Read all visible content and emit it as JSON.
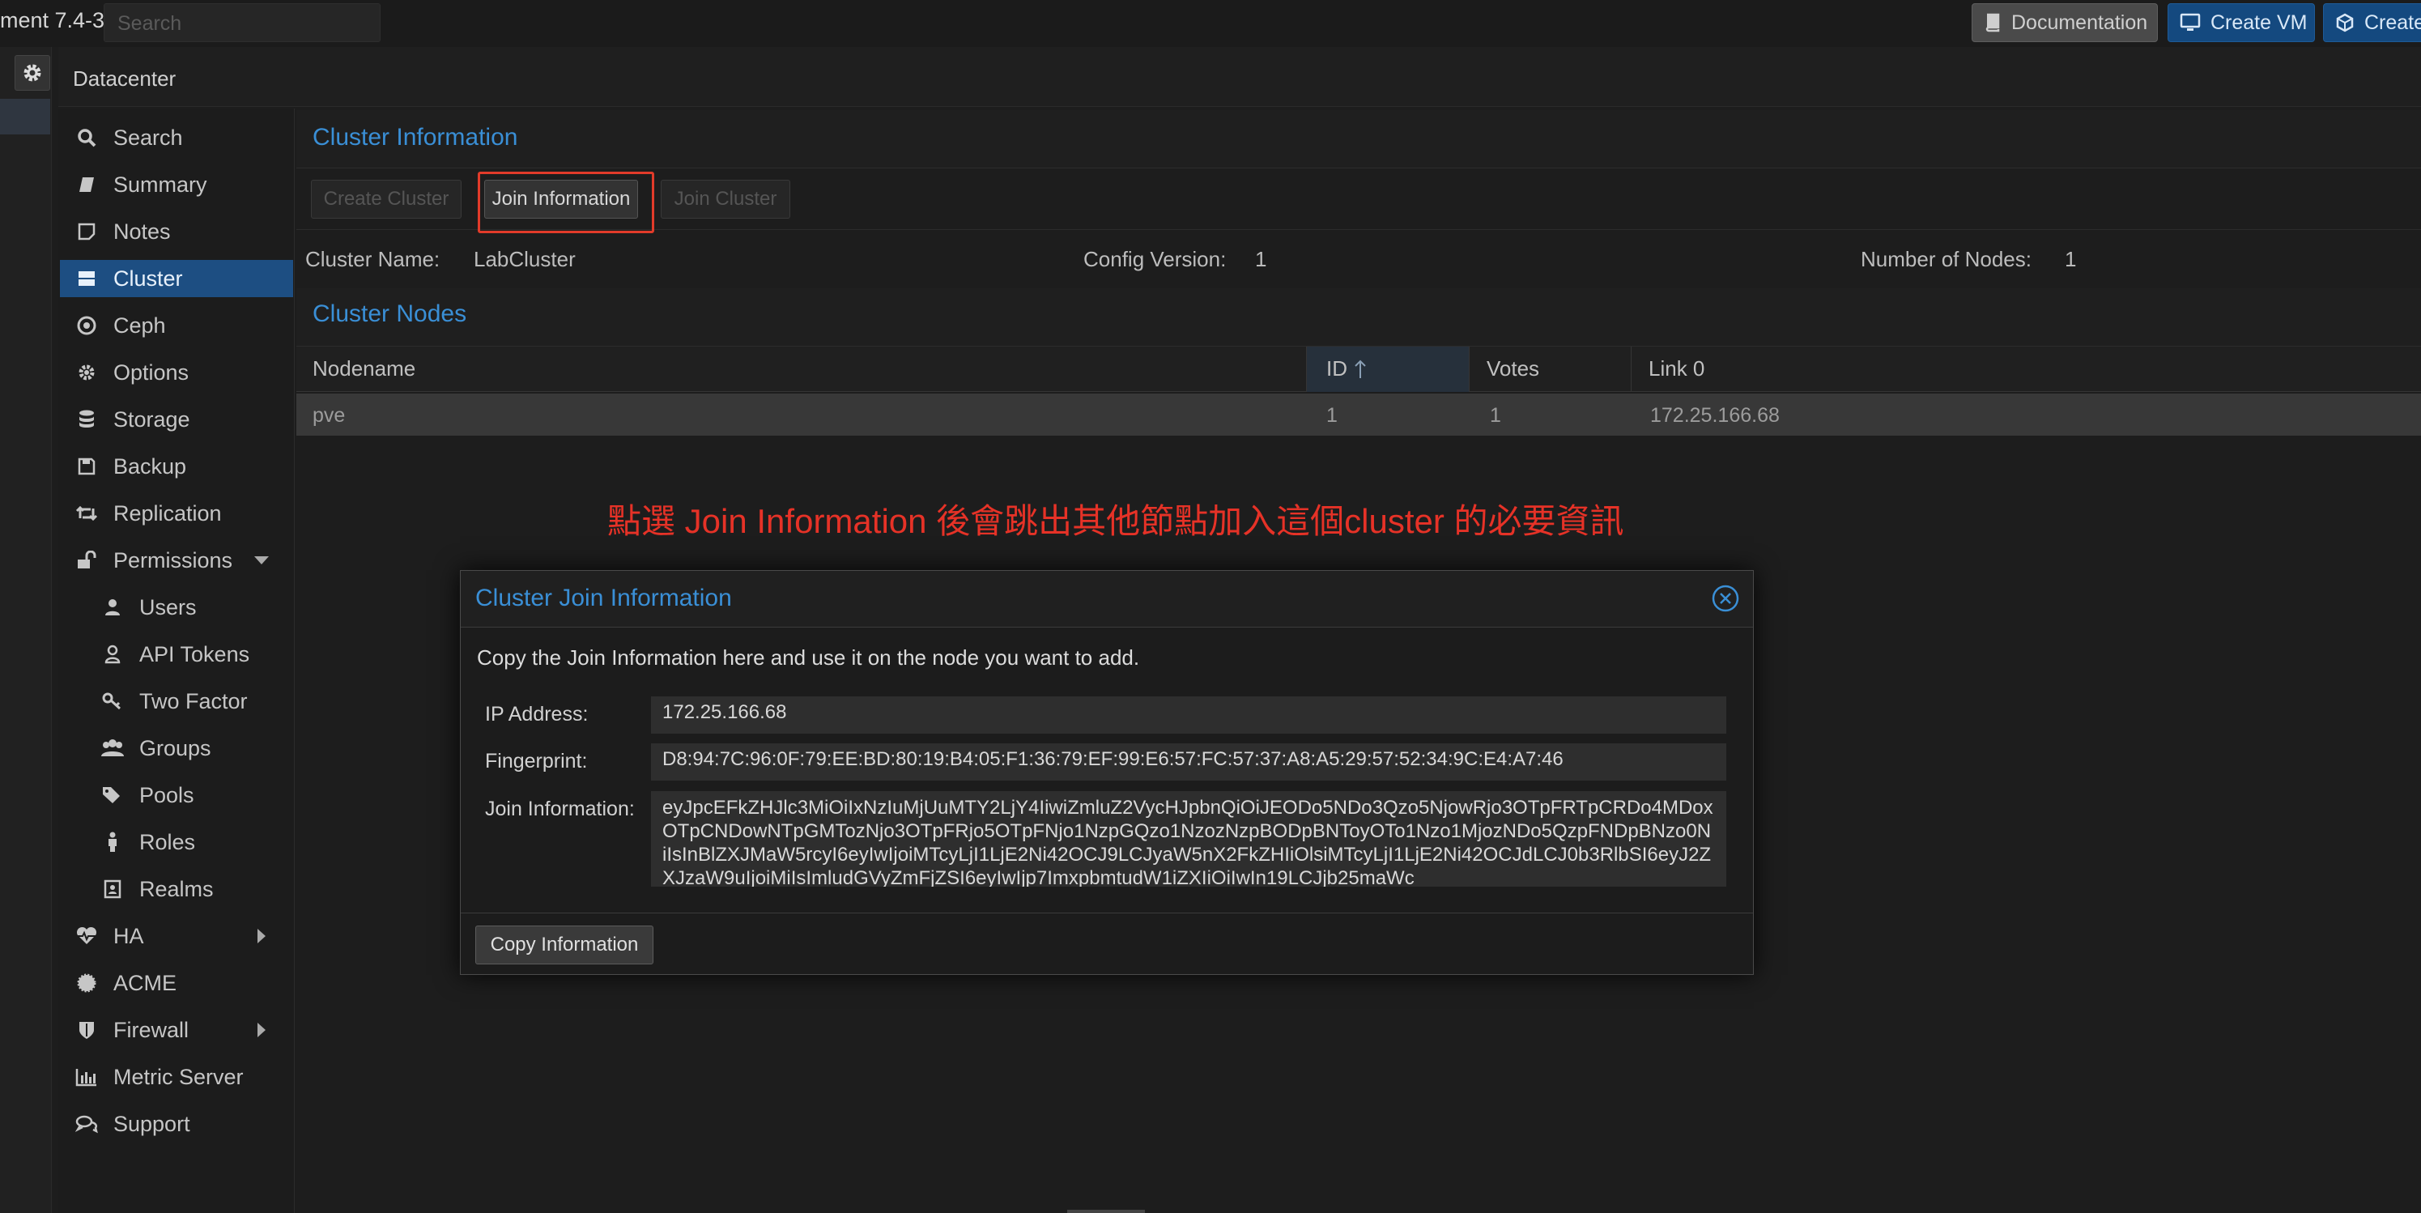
{
  "topbar": {
    "title": "ment 7.4-3",
    "search_placeholder": "Search",
    "documentation": "Documentation",
    "create_vm": "Create VM",
    "create_ct": "Create CT"
  },
  "header": {
    "title": "Datacenter"
  },
  "menu": {
    "items": [
      {
        "label": "Search",
        "icon": "search-icon"
      },
      {
        "label": "Summary",
        "icon": "book-icon"
      },
      {
        "label": "Notes",
        "icon": "note-icon"
      },
      {
        "label": "Cluster",
        "icon": "server-icon"
      },
      {
        "label": "Ceph",
        "icon": "ceph-icon"
      },
      {
        "label": "Options",
        "icon": "gear-icon"
      },
      {
        "label": "Storage",
        "icon": "database-icon"
      },
      {
        "label": "Backup",
        "icon": "floppy-icon"
      },
      {
        "label": "Replication",
        "icon": "retweet-icon"
      },
      {
        "label": "Permissions",
        "icon": "unlock-icon"
      },
      {
        "label": "Users",
        "icon": "user-icon"
      },
      {
        "label": "API Tokens",
        "icon": "user-outline-icon"
      },
      {
        "label": "Two Factor",
        "icon": "key-icon"
      },
      {
        "label": "Groups",
        "icon": "users-icon"
      },
      {
        "label": "Pools",
        "icon": "tags-icon"
      },
      {
        "label": "Roles",
        "icon": "male-icon"
      },
      {
        "label": "Realms",
        "icon": "address-book-icon"
      },
      {
        "label": "HA",
        "icon": "heartbeat-icon"
      },
      {
        "label": "ACME",
        "icon": "certificate-icon"
      },
      {
        "label": "Firewall",
        "icon": "shield-icon"
      },
      {
        "label": "Metric Server",
        "icon": "bar-chart-icon"
      },
      {
        "label": "Support",
        "icon": "comments-icon"
      }
    ]
  },
  "cluster_info": {
    "title": "Cluster Information",
    "buttons": [
      "Create Cluster",
      "Join Information",
      "Join Cluster"
    ],
    "name_label": "Cluster Name:",
    "name_value": "LabCluster",
    "config_label": "Config Version:",
    "config_value": "1",
    "nodes_label": "Number of Nodes:",
    "nodes_value": "1"
  },
  "cluster_nodes": {
    "title": "Cluster Nodes",
    "columns": [
      "Nodename",
      "ID",
      "Votes",
      "Link 0"
    ],
    "rows": [
      {
        "nodename": "pve",
        "id": "1",
        "votes": "1",
        "link0": "172.25.166.68"
      }
    ]
  },
  "annotation": "點選 Join Information 後會跳出其他節點加入這個cluster 的必要資訊",
  "modal": {
    "title": "Cluster Join Information",
    "description": "Copy the Join Information here and use it on the node you want to add.",
    "ip_label": "IP Address:",
    "ip_value": "172.25.166.68",
    "fingerprint_label": "Fingerprint:",
    "fingerprint_value": "D8:94:7C:96:0F:79:EE:BD:80:19:B4:05:F1:36:79:EF:99:E6:57:FC:57:37:A8:A5:29:57:52:34:9C:E4:A7:46",
    "join_label": "Join Information:",
    "join_value": "eyJpcEFkZHJlc3MiOiIxNzIuMjUuMTY2LjY4IiwiZmluZ2VycHJpbnQiOiJEODo5NDo3Qzo5NjowRjo3OTpFRTpCRDo4MDoxOTpCNDowNTpGMTozNjo3OTpFRjo5OTpFNjo1NzpGQzo1NzozNzpBODpBNToyOTo1Nzo1MjozNDo5QzpFNDpBNzo0NiIsInBlZXJMaW5rcyI6eyIwIjoiMTcyLjI1LjE2Ni42OCJ9LCJyaW5nX2FkZHIiOlsiMTcyLjI1LjE2Ni42OCJdLCJ0b3RlbSI6eyJ2ZXJzaW9uIjoiMiIsImludGVyZmFjZSI6eyIwIjp7ImxpbmtudW1iZXIiOiIwIn19LCJjb25maWc",
    "copy_button": "Copy Information"
  },
  "colors": {
    "accent": "#3a8fd6",
    "selection": "#1d4e82",
    "annotation_red": "#e63227"
  }
}
